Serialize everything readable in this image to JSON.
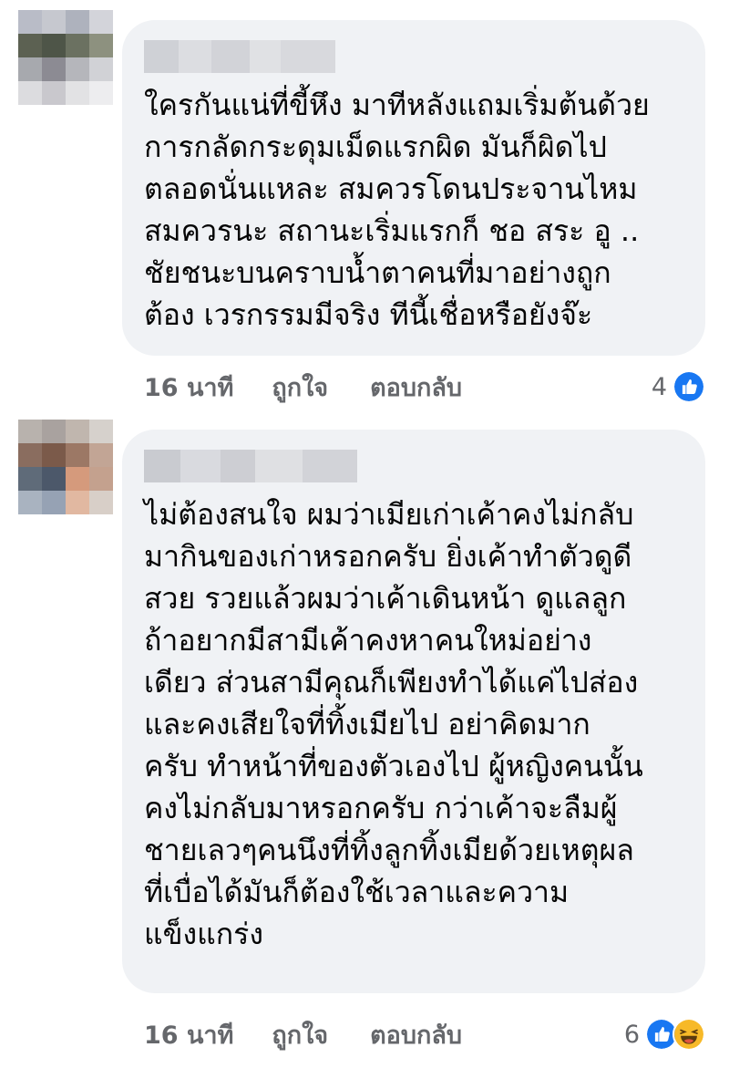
{
  "comments": [
    {
      "text": "ใครกันแน่ที่ขี้หึง มาทีหลังแถมเริ่มต้นด้วย\nการกลัดกระดุมเม็ดแรกผิด มันก็ผิดไป\nตลอดนั่นแหละ  สมควรโดนประจานไหม\nสมควรนะ สถานะเริ่มแรกก็ ชอ สระ อู ..\nชัยชนะบนคราบน้ำตาคนที่มาอย่างถูก\nต้อง  เวรกรรมมีจริง ทีนี้เชื่อหรือยังจ๊ะ",
      "time": "16 นาที",
      "like_label": "ถูกใจ",
      "reply_label": "ตอบกลับ",
      "reaction_count": "4",
      "reactions": [
        "like-reaction-icon"
      ]
    },
    {
      "text": "ไม่ต้องสนใจ ผมว่าเมียเก่าเค้าคงไม่กลับ\nมากินของเก่าหรอกครับ ยิ่งเค้าทำตัวดูดี\nสวย รวยแล้วผมว่าเค้าเดินหน้า ดูแลลูก\nถ้าอยากมีสามีเค้าคงหาคนใหม่อย่าง\nเดียว ส่วนสามีคุณก็เพียงทำได้แค่ไปส่อง\nและคงเสียใจที่ทิ้งเมียไป อย่าคิดมาก\nครับ ทำหน้าที่ของตัวเองไป ผู้หญิงคนนั้น\nคงไม่กลับมาหรอกครับ กว่าเค้าจะลืมผู้\nชายเลวๆคนนึงที่ทิ้งลูกทิ้งเมียด้วยเหตุผล\nที่เบื่อได้มันก็ต้องใช้เวลาและความ\nแข็งแกร่ง",
      "time": "16 นาที",
      "like_label": "ถูกใจ",
      "reply_label": "ตอบกลับ",
      "reaction_count": "6",
      "reactions": [
        "like-reaction-icon",
        "haha-reaction-icon"
      ]
    }
  ],
  "colors": {
    "bubble": "#f0f2f5",
    "meta_text": "#65676b",
    "like_blue": "#1877f2",
    "haha_yellow": "#f7b928"
  }
}
